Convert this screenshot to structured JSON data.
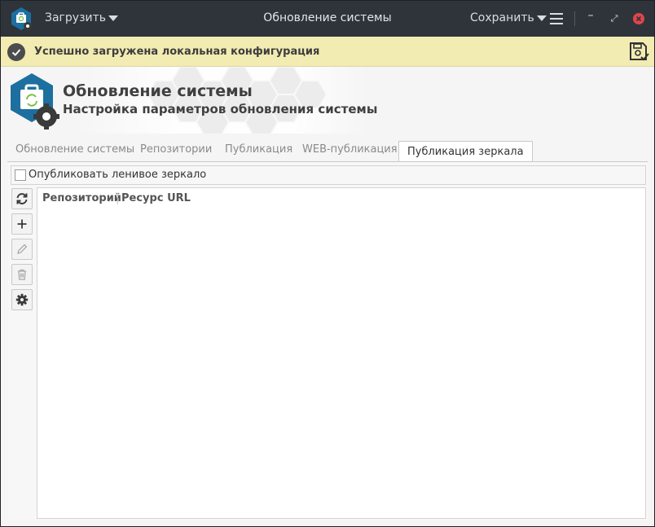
{
  "titlebar": {
    "load_label": "Загрузить",
    "window_title": "Обновление системы",
    "save_label": "Сохранить",
    "minimize_glyph": "–",
    "maximize_glyph": "⤢"
  },
  "notification": {
    "text": "Успешно загружена локальная конфигурация",
    "icon": "check-circle-icon"
  },
  "header": {
    "title": "Обновление системы",
    "subtitle": "Настройка параметров обновления системы"
  },
  "tabs": [
    {
      "label": "Обновление системы",
      "active": false
    },
    {
      "label": "Репозитории",
      "active": false
    },
    {
      "label": "Публикация",
      "active": false
    },
    {
      "label": "WEB-публикация",
      "active": false
    },
    {
      "label": "Публикация зеркала",
      "active": true
    }
  ],
  "mirror": {
    "lazy_checkbox_label": "Опубликовать ленивое зеркало",
    "lazy_checked": false,
    "toolbar": [
      "refresh-icon",
      "add-icon",
      "edit-icon",
      "delete-icon",
      "settings-icon"
    ],
    "columns": [
      "Репозиторий",
      "Ресурс URL"
    ],
    "rows": []
  },
  "colors": {
    "titlebar_bg": "#2f343b",
    "notification_bg": "#f2ecb2",
    "accent_blue": "#1d6fa0",
    "close_red": "#e0454c"
  }
}
